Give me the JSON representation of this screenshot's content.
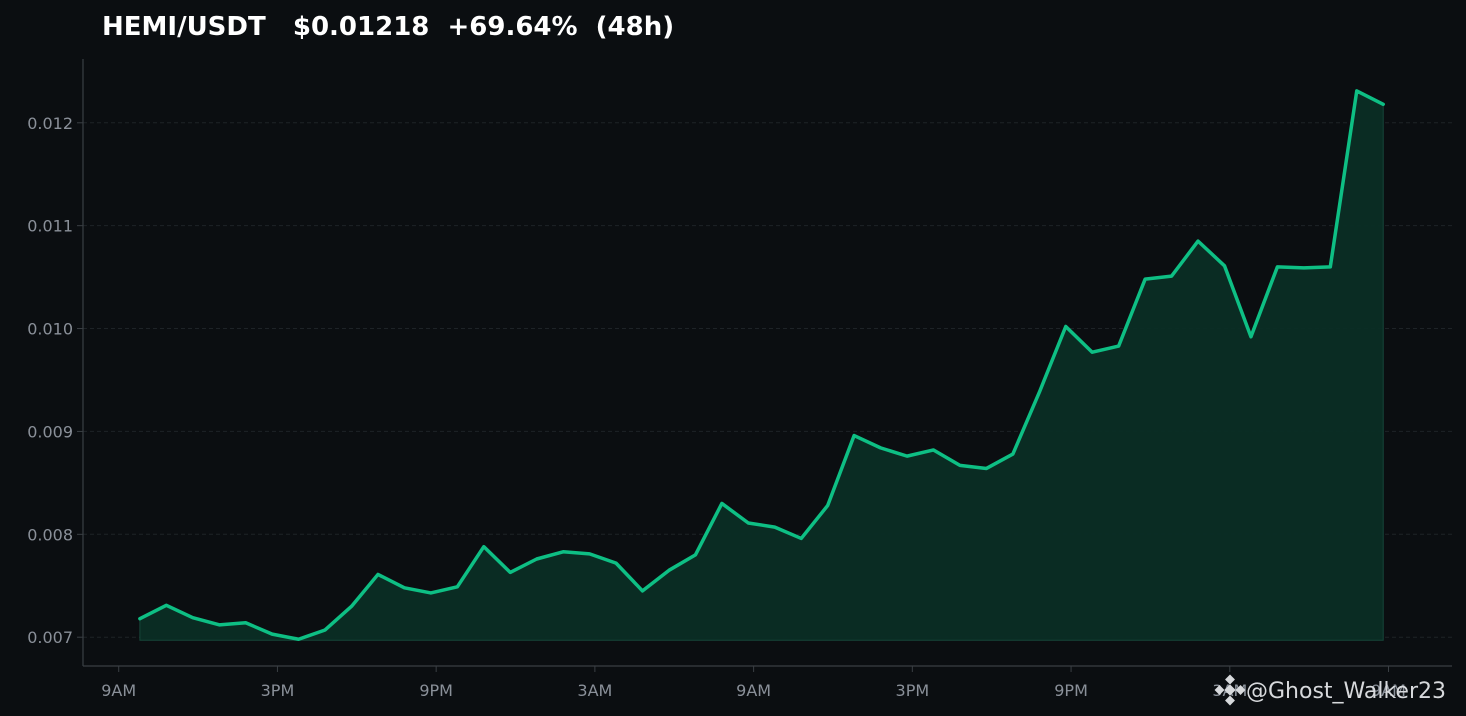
{
  "chart_data": {
    "type": "area",
    "title": "HEMI/USDT   $0.01218  +69.64%  (48h)",
    "xlabel": "",
    "ylabel": "",
    "x": [
      9.8,
      10.8,
      11.8,
      12.8,
      13.8,
      14.8,
      15.8,
      16.8,
      17.8,
      18.8,
      19.8,
      20.8,
      21.8,
      22.8,
      23.8,
      24.8,
      25.8,
      26.8,
      27.8,
      28.8,
      29.8,
      30.8,
      31.8,
      32.8,
      33.8,
      34.8,
      35.8,
      36.8,
      37.8,
      38.8,
      39.8,
      40.8,
      41.8,
      42.8,
      43.8,
      44.8,
      45.8,
      46.8,
      47.8,
      48.8,
      49.8,
      50.8,
      51.8,
      52.8,
      53.8,
      54.8,
      55.8,
      56.8
    ],
    "values": [
      0.00718,
      0.00731,
      0.00719,
      0.00712,
      0.00714,
      0.00703,
      0.00698,
      0.00707,
      0.0073,
      0.00761,
      0.00748,
      0.00743,
      0.00749,
      0.00788,
      0.00763,
      0.00776,
      0.00783,
      0.00781,
      0.00772,
      0.00745,
      0.00765,
      0.0078,
      0.0083,
      0.00811,
      0.00807,
      0.00796,
      0.00828,
      0.00896,
      0.00884,
      0.00876,
      0.00882,
      0.00867,
      0.00864,
      0.00878,
      0.00938,
      0.01002,
      0.00977,
      0.00983,
      0.01048,
      0.01051,
      0.01085,
      0.01061,
      0.00992,
      0.0106,
      0.01059,
      0.0106,
      0.01231,
      0.01218
    ],
    "x_ticks": [
      {
        "pos": 9,
        "label": "9AM"
      },
      {
        "pos": 15,
        "label": "3PM"
      },
      {
        "pos": 21,
        "label": "9PM"
      },
      {
        "pos": 27,
        "label": "3AM"
      },
      {
        "pos": 33,
        "label": "9AM"
      },
      {
        "pos": 39,
        "label": "3PM"
      },
      {
        "pos": 45,
        "label": "9PM"
      },
      {
        "pos": 51,
        "label": "3AM"
      },
      {
        "pos": 57,
        "label": "9AM"
      }
    ],
    "xlim": [
      7.65,
      59.4
    ],
    "y_ticks": [
      0.007,
      0.008,
      0.009,
      0.01,
      0.011,
      0.012
    ],
    "y_tick_labels": [
      "0.007",
      "0.008",
      "0.009",
      "0.010",
      "0.011",
      "0.012"
    ],
    "ylim": [
      0.00672,
      0.01262
    ],
    "area_baseline": 0.00697,
    "grid": true,
    "legend": "none",
    "colors": {
      "background": "#0b0e11",
      "line": "#0ebf84",
      "fill": "#0a2e25",
      "grid": "#1e2327",
      "axis": "#3a3f44",
      "tick_text": "#8a9099",
      "title": "#ffffff"
    }
  },
  "watermark": {
    "text": "@Ghost_Walker23",
    "icon": "binance-logo-icon"
  }
}
